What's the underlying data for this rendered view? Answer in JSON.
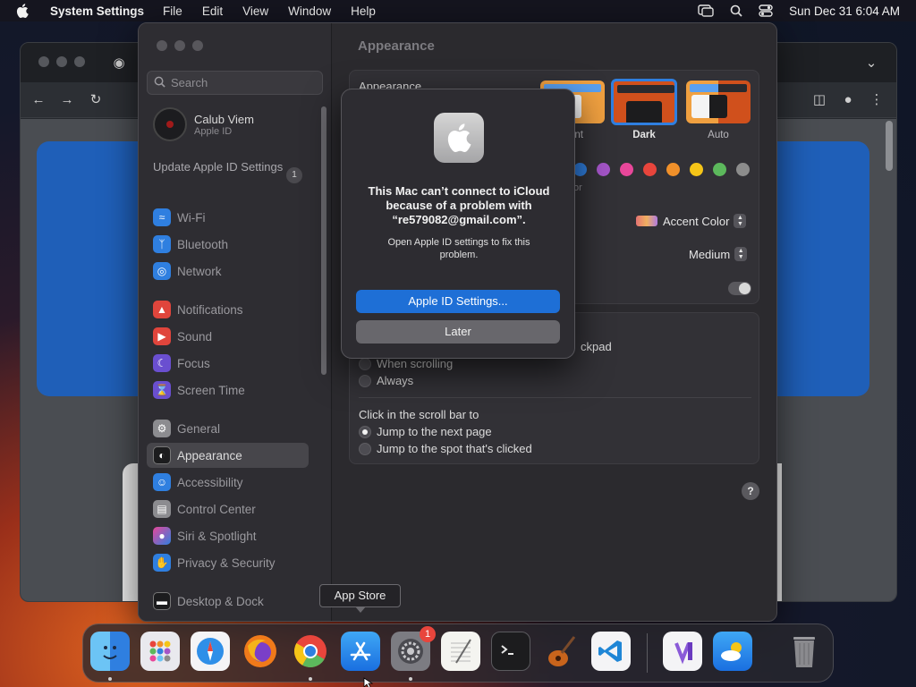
{
  "menubar": {
    "app_name": "System Settings",
    "menus": [
      "File",
      "Edit",
      "View",
      "Window",
      "Help"
    ],
    "clock": "Sun Dec 31  6:04 AM",
    "icons": [
      "apple-icon",
      "screen-mirroring-icon",
      "spotlight-search-icon",
      "control-center-icon"
    ]
  },
  "settings": {
    "search_placeholder": "Search",
    "profile": {
      "name": "Calub Viem",
      "subtitle": "Apple ID"
    },
    "update": {
      "label": "Update Apple ID Settings",
      "count": "1"
    },
    "sidebar": [
      {
        "label": "Wi-Fi",
        "icon": "wifi-icon",
        "color": "#2f7fe0"
      },
      {
        "label": "Bluetooth",
        "icon": "bluetooth-icon",
        "color": "#2f7fe0"
      },
      {
        "label": "Network",
        "icon": "globe-icon",
        "color": "#2f7fe0"
      },
      {
        "label": "Notifications",
        "icon": "bell-icon",
        "color": "#e0453c"
      },
      {
        "label": "Sound",
        "icon": "speaker-icon",
        "color": "#e0453c"
      },
      {
        "label": "Focus",
        "icon": "moon-icon",
        "color": "#6a4fd0"
      },
      {
        "label": "Screen Time",
        "icon": "hourglass-icon",
        "color": "#6a4fd0"
      },
      {
        "label": "General",
        "icon": "gear-icon",
        "color": "#8c8c90"
      },
      {
        "label": "Appearance",
        "icon": "appearance-icon",
        "color": "#1c1c1e"
      },
      {
        "label": "Accessibility",
        "icon": "accessibility-icon",
        "color": "#2f7fe0"
      },
      {
        "label": "Control Center",
        "icon": "control-center-icon",
        "color": "#8c8c90"
      },
      {
        "label": "Siri & Spotlight",
        "icon": "siri-icon",
        "color": "#b04fd0"
      },
      {
        "label": "Privacy & Security",
        "icon": "hand-icon",
        "color": "#2f7fe0"
      },
      {
        "label": "Desktop & Dock",
        "icon": "dock-icon",
        "color": "#1c1c1e"
      }
    ],
    "selected": "Appearance",
    "main": {
      "title": "Appearance",
      "appearance_label": "Appearance",
      "appearance_options": [
        {
          "label": "Light",
          "visible_label": "nt"
        },
        {
          "label": "Dark",
          "selected": true
        },
        {
          "label": "Auto"
        }
      ],
      "accent_colors": [
        "#2f7fe0",
        "#a455c8",
        "#e8479a",
        "#e8453c",
        "#f0902a",
        "#f5c518",
        "#5cb85c",
        "#8c8c8c"
      ],
      "accent_label_fragment": "or",
      "highlight_popup": "Accent Color",
      "sidebar_icon_size": "Medium",
      "wallpaper_tinting_toggle": false,
      "scroll_fragment": "ckpad",
      "show_scroll_bars_options": [
        {
          "label": "When scrolling",
          "checked": false
        },
        {
          "label": "Always",
          "checked": false
        }
      ],
      "click_scroll_title": "Click in the scroll bar to",
      "click_scroll_options": [
        {
          "label": "Jump to the next page",
          "checked": true
        },
        {
          "label": "Jump to the spot that's clicked",
          "checked": false
        }
      ],
      "help": "?"
    }
  },
  "alert": {
    "title": "This Mac can’t connect to iCloud because of a problem with “re579082@gmail.com”.",
    "message": "Open Apple ID settings to fix this problem.",
    "primary_button": "Apple ID Settings...",
    "secondary_button": "Later"
  },
  "tooltip": "App Store",
  "dock": [
    {
      "name": "finder",
      "running": true
    },
    {
      "name": "launchpad",
      "running": false
    },
    {
      "name": "safari",
      "running": false
    },
    {
      "name": "firefox",
      "running": false
    },
    {
      "name": "chrome",
      "running": true
    },
    {
      "name": "app-store",
      "running": false
    },
    {
      "name": "system-settings",
      "running": true,
      "badge": "1"
    },
    {
      "name": "textedit",
      "running": false
    },
    {
      "name": "terminal",
      "running": false
    },
    {
      "name": "garageband",
      "running": false
    },
    {
      "name": "vscode",
      "running": false
    },
    {
      "name": "visual-studio",
      "running": false
    },
    {
      "name": "weather",
      "running": false
    },
    {
      "name": "trash",
      "running": false
    }
  ]
}
